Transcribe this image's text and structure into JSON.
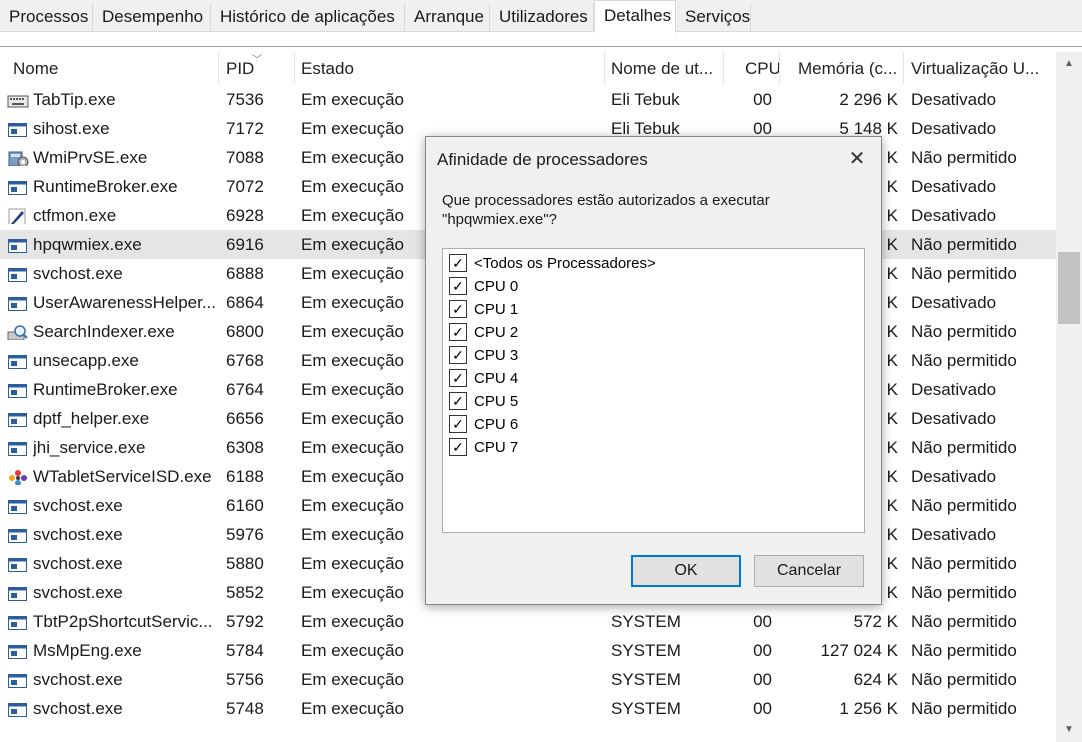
{
  "tabs": [
    "Processos",
    "Desempenho",
    "Histórico de aplicações",
    "Arranque",
    "Utilizadores",
    "Detalhes",
    "Serviços"
  ],
  "active_tab": "Detalhes",
  "columns": [
    "Nome",
    "PID",
    "Estado",
    "Nome de ut...",
    "CPU",
    "Memória (c...",
    "Virtualização U..."
  ],
  "rows": [
    {
      "icon": "keyboard-icon",
      "name": "TabTip.exe",
      "pid": "7536",
      "state": "Em execução",
      "user": "Eli Tebuk",
      "cpu": "00",
      "mem": "2 296 K",
      "virt": "Desativado"
    },
    {
      "icon": "window-app-icon",
      "name": "sihost.exe",
      "pid": "7172",
      "state": "Em execução",
      "user": "Eli Tebuk",
      "cpu": "00",
      "mem": "5 148 K",
      "virt": "Desativado"
    },
    {
      "icon": "wmi-icon",
      "name": "WmiPrvSE.exe",
      "pid": "7088",
      "state": "Em execução",
      "user": "",
      "cpu": "",
      "mem": "K",
      "virt": "Não permitido"
    },
    {
      "icon": "window-app-icon",
      "name": "RuntimeBroker.exe",
      "pid": "7072",
      "state": "Em execução",
      "user": "",
      "cpu": "",
      "mem": "K",
      "virt": "Desativado"
    },
    {
      "icon": "pen-icon",
      "name": "ctfmon.exe",
      "pid": "6928",
      "state": "Em execução",
      "user": "",
      "cpu": "",
      "mem": "K",
      "virt": "Desativado"
    },
    {
      "icon": "window-app-icon",
      "name": "hpqwmiex.exe",
      "pid": "6916",
      "state": "Em execução",
      "user": "",
      "cpu": "",
      "mem": "K",
      "virt": "Não permitido",
      "selected": true
    },
    {
      "icon": "window-app-icon",
      "name": "svchost.exe",
      "pid": "6888",
      "state": "Em execução",
      "user": "",
      "cpu": "",
      "mem": "K",
      "virt": "Não permitido"
    },
    {
      "icon": "window-app-icon",
      "name": "UserAwarenessHelper...",
      "pid": "6864",
      "state": "Em execução",
      "user": "",
      "cpu": "",
      "mem": "K",
      "virt": "Desativado"
    },
    {
      "icon": "search-indexer-icon",
      "name": "SearchIndexer.exe",
      "pid": "6800",
      "state": "Em execução",
      "user": "",
      "cpu": "",
      "mem": "K",
      "virt": "Não permitido"
    },
    {
      "icon": "window-app-icon",
      "name": "unsecapp.exe",
      "pid": "6768",
      "state": "Em execução",
      "user": "",
      "cpu": "",
      "mem": "K",
      "virt": "Não permitido"
    },
    {
      "icon": "window-app-icon",
      "name": "RuntimeBroker.exe",
      "pid": "6764",
      "state": "Em execução",
      "user": "",
      "cpu": "",
      "mem": "K",
      "virt": "Desativado"
    },
    {
      "icon": "window-app-icon",
      "name": "dptf_helper.exe",
      "pid": "6656",
      "state": "Em execução",
      "user": "",
      "cpu": "",
      "mem": "K",
      "virt": "Desativado"
    },
    {
      "icon": "window-app-icon",
      "name": "jhi_service.exe",
      "pid": "6308",
      "state": "Em execução",
      "user": "",
      "cpu": "",
      "mem": "K",
      "virt": "Não permitido"
    },
    {
      "icon": "wacom-icon",
      "name": "WTabletServiceISD.exe",
      "pid": "6188",
      "state": "Em execução",
      "user": "",
      "cpu": "",
      "mem": "K",
      "virt": "Desativado"
    },
    {
      "icon": "window-app-icon",
      "name": "svchost.exe",
      "pid": "6160",
      "state": "Em execução",
      "user": "",
      "cpu": "",
      "mem": "K",
      "virt": "Não permitido"
    },
    {
      "icon": "window-app-icon",
      "name": "svchost.exe",
      "pid": "5976",
      "state": "Em execução",
      "user": "",
      "cpu": "",
      "mem": "K",
      "virt": "Desativado"
    },
    {
      "icon": "window-app-icon",
      "name": "svchost.exe",
      "pid": "5880",
      "state": "Em execução",
      "user": "",
      "cpu": "",
      "mem": "K",
      "virt": "Não permitido"
    },
    {
      "icon": "window-app-icon",
      "name": "svchost.exe",
      "pid": "5852",
      "state": "Em execução",
      "user": "",
      "cpu": "",
      "mem": "K",
      "virt": "Não permitido"
    },
    {
      "icon": "window-app-icon",
      "name": "TbtP2pShortcutServic...",
      "pid": "5792",
      "state": "Em execução",
      "user": "SYSTEM",
      "cpu": "00",
      "mem": "572 K",
      "virt": "Não permitido"
    },
    {
      "icon": "window-app-icon",
      "name": "MsMpEng.exe",
      "pid": "5784",
      "state": "Em execução",
      "user": "SYSTEM",
      "cpu": "00",
      "mem": "127 024 K",
      "virt": "Não permitido"
    },
    {
      "icon": "window-app-icon",
      "name": "svchost.exe",
      "pid": "5756",
      "state": "Em execução",
      "user": "SYSTEM",
      "cpu": "00",
      "mem": "624 K",
      "virt": "Não permitido"
    },
    {
      "icon": "window-app-icon",
      "name": "svchost.exe",
      "pid": "5748",
      "state": "Em execução",
      "user": "SYSTEM",
      "cpu": "00",
      "mem": "1 256 K",
      "virt": "Não permitido"
    }
  ],
  "dialog": {
    "title": "Afinidade de processadores",
    "question": "Que processadores estão autorizados a executar \"hpqwmiex.exe\"?",
    "items": [
      {
        "label": "<Todos os Processadores>",
        "checked": true
      },
      {
        "label": "CPU 0",
        "checked": true
      },
      {
        "label": "CPU 1",
        "checked": true
      },
      {
        "label": "CPU 2",
        "checked": true
      },
      {
        "label": "CPU 3",
        "checked": true
      },
      {
        "label": "CPU 4",
        "checked": true
      },
      {
        "label": "CPU 5",
        "checked": true
      },
      {
        "label": "CPU 6",
        "checked": true
      },
      {
        "label": "CPU 7",
        "checked": true
      }
    ],
    "ok_label": "OK",
    "cancel_label": "Cancelar",
    "close_glyph": "✕"
  },
  "colors": {
    "selection": "#e5e5e5",
    "accent": "#0078d7"
  }
}
